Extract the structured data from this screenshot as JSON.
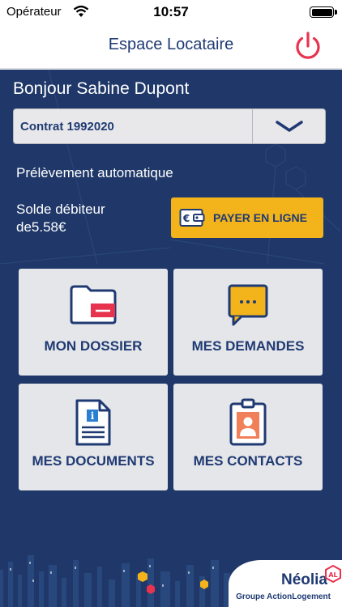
{
  "status_bar": {
    "carrier": "Opérateur",
    "time": "10:57"
  },
  "nav": {
    "title": "Espace Locataire"
  },
  "greeting": {
    "hello": "Bonjour",
    "name": "Sabine Dupont"
  },
  "contract": {
    "value": "Contrat 1992020"
  },
  "payment": {
    "mode": "Prélèvement automatique",
    "balance_label": "Solde débiteur",
    "balance_prefix": "de",
    "balance_amount": "5.58€",
    "pay_button": "PAYER EN LIGNE"
  },
  "tiles": [
    {
      "label": "MON DOSSIER",
      "icon": "folder-icon"
    },
    {
      "label": "MES DEMANDES",
      "icon": "chat-bubble-icon"
    },
    {
      "label": "MES DOCUMENTS",
      "icon": "document-info-icon"
    },
    {
      "label": "MES CONTACTS",
      "icon": "contact-badge-icon"
    }
  ],
  "footer": {
    "brand": "Néolia",
    "badge": "AL",
    "subtitle": "Groupe ActionLogement"
  },
  "colors": {
    "navy": "#1f3869",
    "accent_red": "#e8334f",
    "yellow": "#f2b31b",
    "text_navy": "#1f3a73"
  }
}
